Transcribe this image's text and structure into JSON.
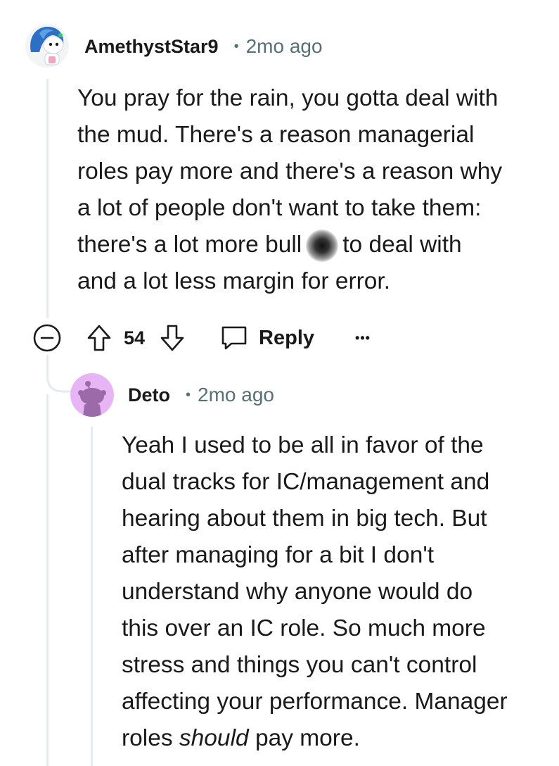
{
  "comments": [
    {
      "author": "AmethystStar9",
      "age": "2mo ago",
      "separator": "•",
      "lines": [
        "You pray for the rain, you gotta deal with",
        "the mud. There's a reason managerial",
        "roles pay more and there's a reason why",
        "a lot of people don't want to take them:"
      ],
      "line5_before_blur": "there's a lot more bull",
      "line5_after_blur": "to deal with",
      "line6": "and a lot less margin for error.",
      "avatar_icon": "blue-haired-snoo-avatar-icon",
      "score": "54",
      "reply_label": "Reply",
      "more_label": "•••"
    },
    {
      "author": "Deto",
      "age": "2mo ago",
      "separator": "•",
      "lines": [
        "Yeah I used to be all in favor of the",
        "dual tracks for IC/management and",
        "hearing about them in big tech. But",
        "after managing for a bit I don't",
        "understand why anyone would do",
        "this over an IC role. So much more",
        "stress and things you can't control",
        "affecting your performance. Manager"
      ],
      "last_line_start": "roles ",
      "last_line_emphasis": "should",
      "last_line_end": " pay more.",
      "avatar_icon": "default-snoo-avatar-icon"
    }
  ],
  "colors": {
    "text": "#1a1a1b",
    "meta": "#576f76",
    "thread_line": "#e5ebee",
    "deto_avatar_bg": "#e7b4f5",
    "deto_snoo": "#9b6aa8"
  }
}
